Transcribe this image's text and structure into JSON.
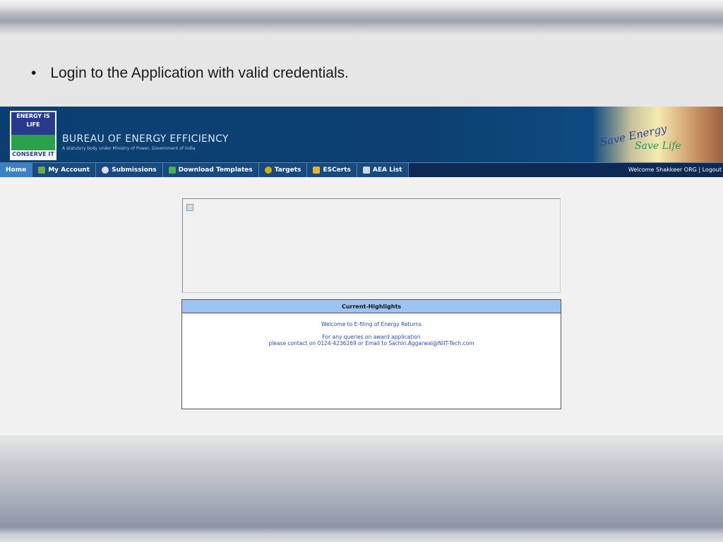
{
  "slide": {
    "bullet": "Login to the Application with valid credentials."
  },
  "header": {
    "logo_top": "ENERGY IS LIFE",
    "logo_bottom": "CONSERVE IT",
    "org_name": "BUREAU OF ENERGY EFFICIENCY",
    "org_subtitle": "A statutory body under Ministry of Power, Government of India",
    "banner_line1": "Save Energy",
    "banner_line2": "Save Life"
  },
  "nav": {
    "items": [
      {
        "label": "Home"
      },
      {
        "label": "My Account",
        "icon": "account-icon",
        "color": "#6aa84f"
      },
      {
        "label": "Submissions",
        "icon": "search-gear-icon",
        "color": "#dde"
      },
      {
        "label": "Download Templates",
        "icon": "download-icon",
        "color": "#4caf50"
      },
      {
        "label": "Targets",
        "icon": "target-icon",
        "color": "#c8b400"
      },
      {
        "label": "ESCerts",
        "icon": "certificate-icon",
        "color": "#f0b030"
      },
      {
        "label": "AEA List",
        "icon": "list-icon",
        "color": "#cfd8dc"
      }
    ],
    "welcome": "Welcome Shakkeer ORG | Logout"
  },
  "highlights": {
    "title": "Current-Highlights",
    "line1": "Welcome to E-filing of Energy Returns",
    "line2": "For any queries on award application",
    "line3": "please contact on 0124-4236269 or Email to Sachin.Aggarwal@NIIT-Tech.com"
  }
}
